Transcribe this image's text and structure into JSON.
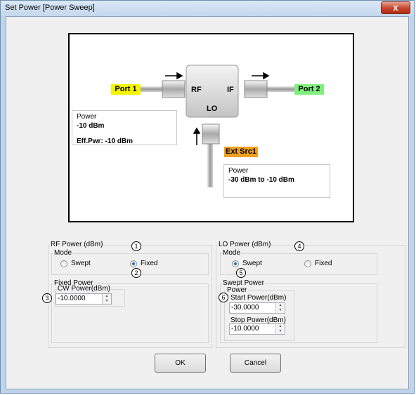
{
  "window": {
    "title": "Set Power [Power Sweep]",
    "close_glyph": "x"
  },
  "diagram": {
    "port1": "Port 1",
    "port2": "Port 2",
    "rf": "RF",
    "if": "IF",
    "lo": "LO",
    "ext_src": "Ext Src1",
    "rf_box": {
      "title": "Power",
      "value": "-10  dBm",
      "eff": "Eff.Pwr: -10  dBm"
    },
    "lo_box": {
      "title": "Power",
      "value": "-30 dBm to -10 dBm"
    },
    "colors": {
      "port1": "#f5f500",
      "port2": "#7ff07f",
      "ext_src": "#f0a020"
    }
  },
  "rf_power": {
    "title": "RF Power (dBm)",
    "mode_title": "Mode",
    "swept_label": "Swept",
    "fixed_label": "Fixed",
    "selected": "Fixed",
    "fixed_power_title": "Fixed Power",
    "cw_label": "CW Power(dBm)",
    "cw_value": "-10.0000"
  },
  "lo_power": {
    "title": "LO Power (dBm)",
    "mode_title": "Mode",
    "swept_label": "Swept",
    "fixed_label": "Fixed",
    "selected": "Swept",
    "swept_power_title": "Swept Power",
    "power_title": "Power",
    "start_label": "Start Power(dBm)",
    "start_value": "-30.0000",
    "stop_label": "Stop Power(dBm)",
    "stop_value": "-10.0000"
  },
  "callouts": [
    "1",
    "2",
    "3",
    "4",
    "5",
    "6"
  ],
  "buttons": {
    "ok": "OK",
    "cancel": "Cancel"
  }
}
